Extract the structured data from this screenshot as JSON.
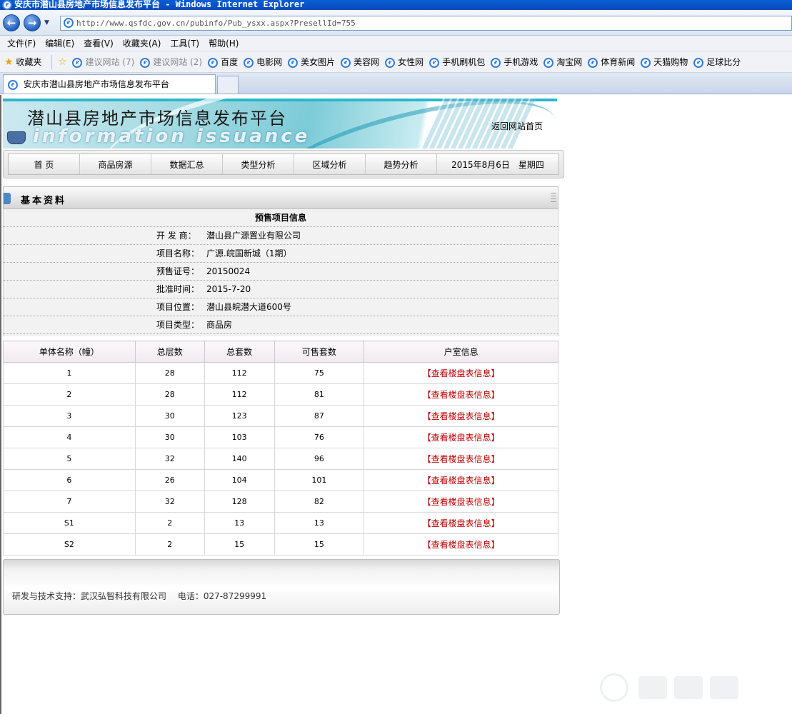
{
  "browser": {
    "window_title": "安庆市潜山县房地产市场信息发布平台 - Windows Internet Explorer",
    "address": "http://www.qsfdc.gov.cn/pubinfo/Pub_ysxx.aspx?PresellId=755",
    "menu": [
      "文件(F)",
      "编辑(E)",
      "查看(V)",
      "收藏夹(A)",
      "工具(T)",
      "帮助(H)"
    ],
    "favorites_label": "收藏夹",
    "favorites": [
      {
        "label": "建议网站 (7)",
        "grey": true
      },
      {
        "label": "建议网站 (2)",
        "grey": true
      },
      {
        "label": "百度",
        "grey": false
      },
      {
        "label": "电影网",
        "grey": false
      },
      {
        "label": "美女图片",
        "grey": false
      },
      {
        "label": "美容网",
        "grey": false
      },
      {
        "label": "女性网",
        "grey": false
      },
      {
        "label": "手机刷机包",
        "grey": false
      },
      {
        "label": "手机游戏",
        "grey": false
      },
      {
        "label": "淘宝网",
        "grey": false
      },
      {
        "label": "体育新闻",
        "grey": false
      },
      {
        "label": "天猫购物",
        "grey": false
      },
      {
        "label": "足球比分",
        "grey": false
      }
    ],
    "tab_title": "安庆市潜山县房地产市场信息发布平台"
  },
  "banner": {
    "title": "潜山县房地产市场信息发布平台",
    "subtitle": "information issuance",
    "back_home": "返回网站首页"
  },
  "nav": {
    "items": [
      "首 页",
      "商品房源",
      "数据汇总",
      "类型分析",
      "区域分析",
      "趋势分析"
    ],
    "date": "2015年8月6日　星期四"
  },
  "section": {
    "title": "基本资料"
  },
  "info": {
    "title": "预售项目信息",
    "rows": [
      {
        "label": "开 发 商：",
        "value": "潜山县广源置业有限公司"
      },
      {
        "label": "项目名称：",
        "value": "广源.皖国新城（1期）"
      },
      {
        "label": "预售证号：",
        "value": "20150024"
      },
      {
        "label": "批准时间：",
        "value": "2015-7-20"
      },
      {
        "label": "项目位置：",
        "value": "潜山县皖潜大道600号"
      },
      {
        "label": "项目类型：",
        "value": "商品房"
      }
    ]
  },
  "units": {
    "headers": [
      "单体名称（幢）",
      "总层数",
      "总套数",
      "可售套数",
      "户室信息"
    ],
    "link_label": "【查看楼盘表信息】",
    "rows": [
      [
        "1",
        "28",
        "112",
        "75"
      ],
      [
        "2",
        "28",
        "112",
        "81"
      ],
      [
        "3",
        "30",
        "123",
        "87"
      ],
      [
        "4",
        "30",
        "103",
        "76"
      ],
      [
        "5",
        "32",
        "140",
        "96"
      ],
      [
        "6",
        "26",
        "104",
        "101"
      ],
      [
        "7",
        "32",
        "128",
        "82"
      ],
      [
        "S1",
        "2",
        "13",
        "13"
      ],
      [
        "S2",
        "2",
        "15",
        "15"
      ]
    ]
  },
  "footer": {
    "text": "研发与技术支持：武汉弘智科技有限公司　 电话：027-87299991"
  },
  "colors": {
    "link_red": "#c00000",
    "titlebar_blue": "#0a5fd6",
    "banner_teal": "#2bb7c9"
  }
}
